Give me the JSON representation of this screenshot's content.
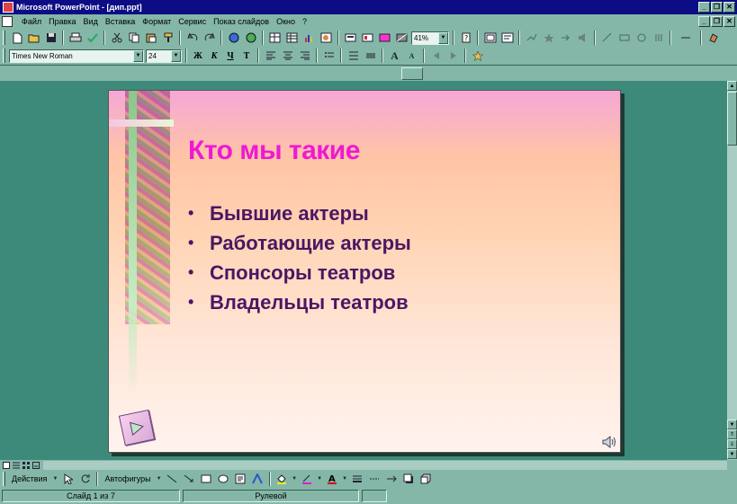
{
  "app": {
    "title": "Microsoft PowerPoint - [дип.ppt]",
    "window_buttons": [
      "_",
      "❐",
      "✕"
    ]
  },
  "menu": {
    "items": [
      "Файл",
      "Правка",
      "Вид",
      "Вставка",
      "Формат",
      "Сервис",
      "Показ слайдов",
      "Окно",
      "?"
    ]
  },
  "toolbar_standard": {
    "zoom": "41%"
  },
  "toolbar_format": {
    "font_name": "Times New Roman",
    "font_size": "24",
    "bold": "Ж",
    "italic": "К",
    "underline": "Ч",
    "shadow": "Т"
  },
  "slide": {
    "title": "Кто мы такие",
    "bullet_char": "•",
    "bullets": [
      "Бывшие актеры",
      "Работающие актеры",
      "Спонсоры театров",
      "Владельцы театров"
    ]
  },
  "toolbar_draw": {
    "actions_label": "Действия",
    "autoshapes_label": "Автофигуры"
  },
  "status": {
    "slide_info": "Слайд 1 из 7",
    "design": "Рулевой"
  },
  "colors": {
    "title": "#ef19d4",
    "bullets": "#4b1663",
    "workspace": "#3e8a7a"
  }
}
